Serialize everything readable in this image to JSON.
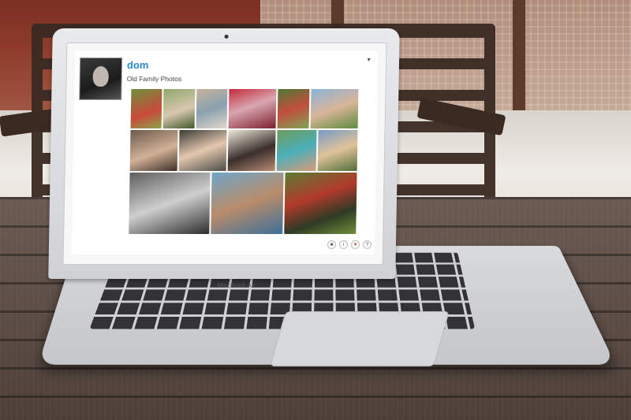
{
  "screen": {
    "user_name": "dom",
    "album_title": "Old Family Photos",
    "menu_icon": "chevron-down-icon",
    "photo_count": 14,
    "action_icons": [
      "camera-icon",
      "info-icon",
      "heart-icon",
      "help-icon"
    ]
  },
  "laptop": {
    "brand_label": "MacBook Air"
  }
}
